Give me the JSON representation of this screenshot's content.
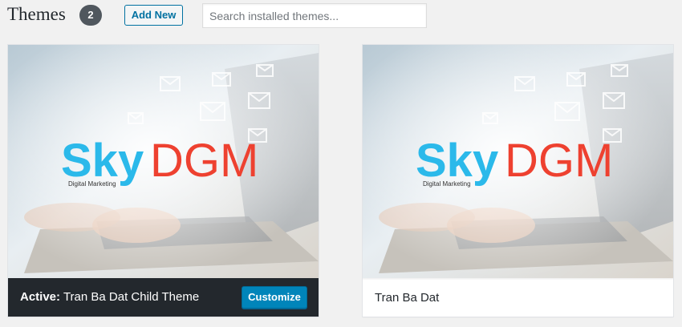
{
  "header": {
    "title": "Themes",
    "count": "2",
    "add_new_label": "Add New",
    "search_placeholder": "Search installed themes..."
  },
  "themes": [
    {
      "logo_sky": "Sky",
      "logo_dgm": "DGM",
      "logo_tagline": "Digital Marketing",
      "active_label": "Active:",
      "name": "Tran Ba Dat Child Theme",
      "customize_label": "Customize",
      "active": true
    },
    {
      "logo_sky": "Sky",
      "logo_dgm": "DGM",
      "logo_tagline": "Digital Marketing",
      "name": "Tran Ba Dat",
      "active": false
    }
  ],
  "colors": {
    "logo_sky": "#2bb9ea",
    "logo_dgm": "#ee4130",
    "active_bar": "#23282d",
    "button_primary": "#0085ba"
  }
}
